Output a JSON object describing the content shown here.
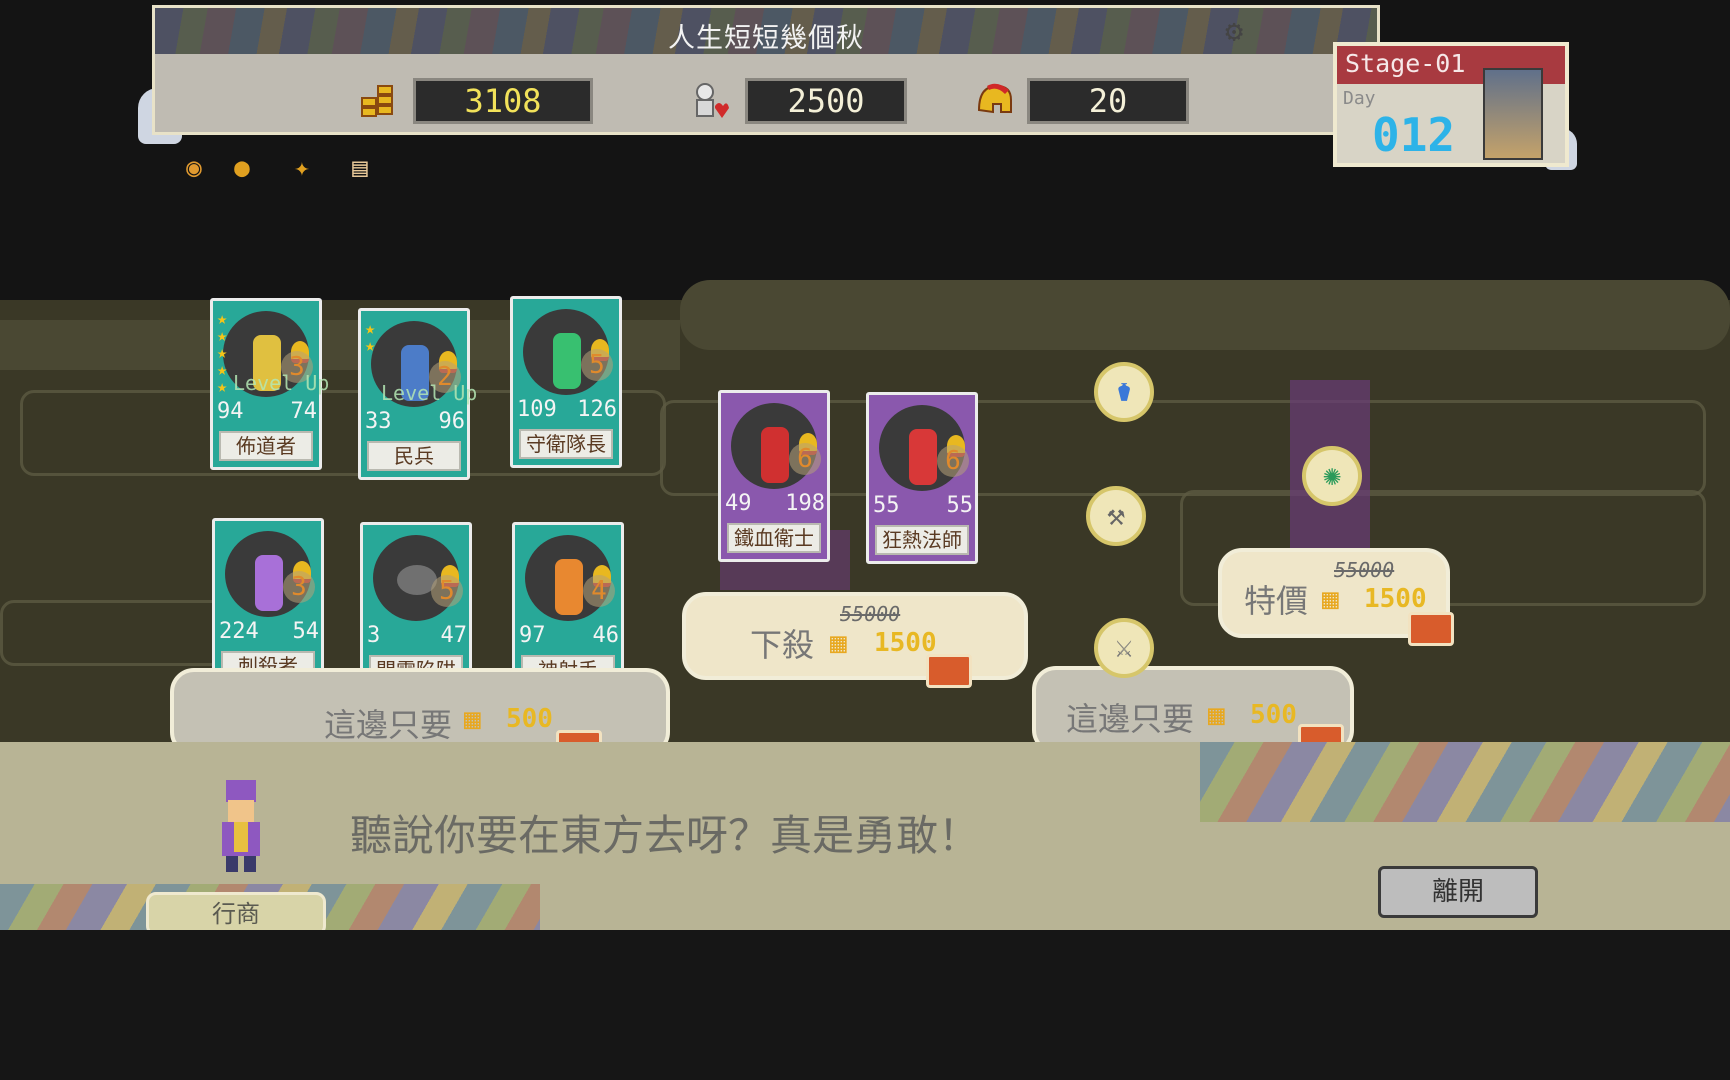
{
  "game_title": "人生短短幾個秋",
  "resources": {
    "gold": "3108",
    "population": "2500",
    "helmets": "20"
  },
  "stage": {
    "label": "Stage-01",
    "day_label": "Day",
    "day": "012"
  },
  "toolbar_icons": [
    "eye-icon",
    "money-bag-icon",
    "magic-wand-icon",
    "scroll-icon"
  ],
  "units": [
    {
      "name": "佈道者",
      "atk": "94",
      "hp": "74",
      "level": "3",
      "stars": 5,
      "level_up": "Level Up",
      "color": "#e0c040"
    },
    {
      "name": "民兵",
      "atk": "33",
      "hp": "96",
      "level": "2",
      "stars": 2,
      "level_up": "Level Up",
      "color": "#4c7cc8"
    },
    {
      "name": "守衛隊長",
      "atk": "109",
      "hp": "126",
      "level": "5",
      "stars": 0,
      "level_up": "",
      "color": "#38c070"
    },
    {
      "name": "刺殺者",
      "atk": "224",
      "hp": "54",
      "level": "3",
      "stars": 0,
      "level_up": "",
      "color": "#a870d8"
    },
    {
      "name": "閃電陷阱",
      "atk": "3",
      "hp": "47",
      "level": "5",
      "stars": 0,
      "level_up": "",
      "color": "#707070"
    },
    {
      "name": "神射手",
      "atk": "97",
      "hp": "46",
      "level": "4",
      "stars": 0,
      "level_up": "",
      "color": "#e88830"
    }
  ],
  "rare_units": [
    {
      "name": "鐵血衛士",
      "atk": "49",
      "hp": "198",
      "level": "6",
      "color": "#d03030"
    },
    {
      "name": "狂熱法師",
      "atk": "55",
      "hp": "55",
      "level": "6",
      "color": "#d83838"
    }
  ],
  "offers": {
    "left_plate": {
      "label": "這邊只要",
      "price": "500"
    },
    "middle_plate": {
      "label": "下殺",
      "old_price": "55000",
      "price": "1500"
    },
    "right_plate": {
      "label": "這邊只要",
      "price": "500"
    },
    "special_plate": {
      "label": "特價",
      "old_price": "55000",
      "price": "1500"
    }
  },
  "items": [
    "potion-icon",
    "axe-icon",
    "sword-icon",
    "spiral-blade-icon"
  ],
  "dialog": {
    "text": "聽說你要在東方去呀？真是勇敢！",
    "speaker": "行商",
    "leave_button": "離開"
  },
  "colors": {
    "gold_text": "#e8b824",
    "day_number": "#2db3e8",
    "card_common": "#28a898",
    "card_rare": "#8a58ad",
    "stage_header": "#a83a40"
  }
}
